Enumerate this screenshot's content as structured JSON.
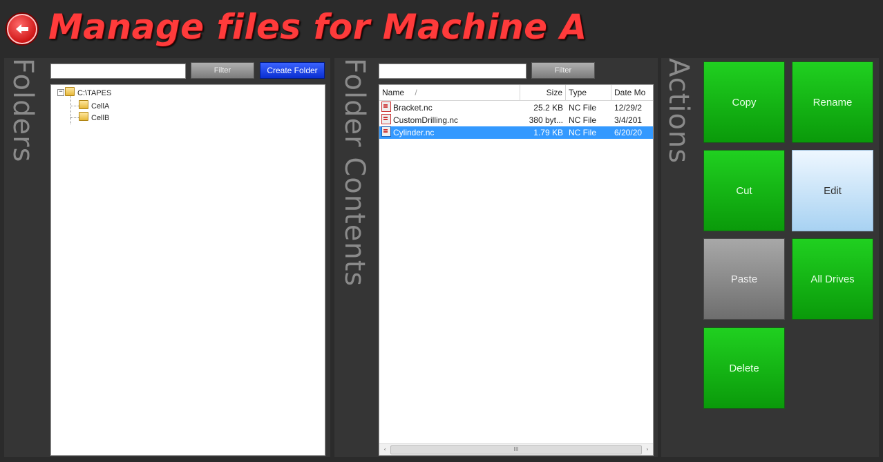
{
  "header": {
    "title": "Manage files for Machine A",
    "back_icon": "arrow-left-circle-icon"
  },
  "folders_panel": {
    "label": "Folders",
    "filter_value": "",
    "filter_button": "Filter",
    "create_folder_button": "Create Folder",
    "tree": {
      "root": "C:\\TAPES",
      "children": [
        "CellA",
        "CellB"
      ]
    }
  },
  "contents_panel": {
    "label": "Folder Contents",
    "filter_value": "",
    "filter_button": "Filter",
    "columns": [
      "Name",
      "Size",
      "Type",
      "Date Mo"
    ],
    "sort_indicator": "/",
    "files": [
      {
        "name": "Bracket.nc",
        "size": "25.2 KB",
        "type": "NC File",
        "date": "12/29/2",
        "selected": false
      },
      {
        "name": "CustomDrilling.nc",
        "size": "380 byt...",
        "type": "NC File",
        "date": "3/4/201",
        "selected": false
      },
      {
        "name": "Cylinder.nc",
        "size": "1.79 KB",
        "type": "NC File",
        "date": "6/20/20",
        "selected": true
      }
    ],
    "scroll_left": "‹",
    "scroll_right": "›",
    "scroll_grip": "III"
  },
  "actions_panel": {
    "label": "Actions",
    "buttons": {
      "copy": "Copy",
      "rename": "Rename",
      "cut": "Cut",
      "edit": "Edit",
      "paste": "Paste",
      "all_drives": "All Drives",
      "delete": "Delete"
    }
  },
  "colors": {
    "title_red": "#ff3b3b",
    "action_green": "#12b812",
    "selection_blue": "#3399ff",
    "create_folder_blue": "#1a44e8"
  }
}
